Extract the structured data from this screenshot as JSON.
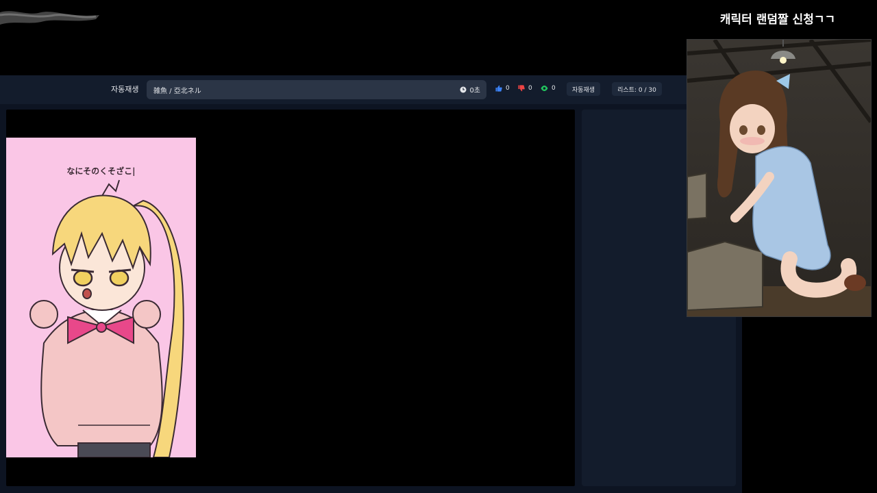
{
  "header": {
    "autoplay_label": "자동재생",
    "now_playing_title": "雑魚 / 亞北ネル",
    "timer": "0초"
  },
  "stats": {
    "likes": "0",
    "dislikes": "0",
    "views": "0"
  },
  "buttons": {
    "autoplay": "자동재생",
    "list": "리스트: 0 / 30"
  },
  "thumbnail": {
    "caption": "なにそのくそざこ|"
  },
  "overlay": {
    "request_title": "캐릭터 랜덤짤 신청ㄱㄱ"
  },
  "colors": {
    "like": "#3b82f6",
    "dislike": "#ef4444",
    "view": "#22c55e",
    "thumb_bg": "#fac6e6"
  },
  "icons": {
    "timer": "clock-icon",
    "like": "thumbs-up-icon",
    "dislike": "thumbs-down-icon",
    "view": "eye-icon"
  }
}
